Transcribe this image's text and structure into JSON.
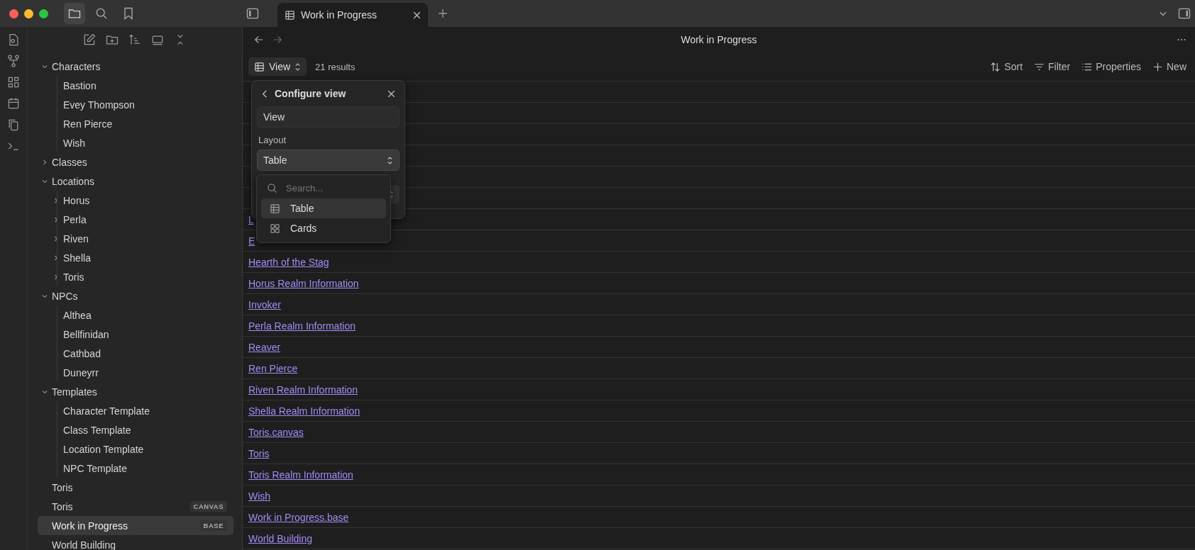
{
  "tab": {
    "title": "Work in Progress"
  },
  "header": {
    "title": "Work in Progress"
  },
  "toolbar": {
    "view_label": "View",
    "results": "21 results",
    "actions": [
      {
        "kind": "sort",
        "label": "Sort"
      },
      {
        "kind": "filter",
        "label": "Filter"
      },
      {
        "kind": "properties",
        "label": "Properties"
      },
      {
        "kind": "new",
        "label": "New"
      }
    ]
  },
  "sidebar": {
    "items": [
      {
        "kind": "folder",
        "label": "Characters",
        "expanded": true,
        "children": [
          {
            "kind": "file",
            "label": "Bastion"
          },
          {
            "kind": "file",
            "label": "Evey Thompson"
          },
          {
            "kind": "file",
            "label": "Ren Pierce"
          },
          {
            "kind": "file",
            "label": "Wish"
          }
        ]
      },
      {
        "kind": "folder",
        "label": "Classes",
        "expanded": false
      },
      {
        "kind": "folder",
        "label": "Locations",
        "expanded": true,
        "children": [
          {
            "kind": "folder",
            "label": "Horus",
            "expanded": false
          },
          {
            "kind": "folder",
            "label": "Perla",
            "expanded": false
          },
          {
            "kind": "folder",
            "label": "Riven",
            "expanded": false
          },
          {
            "kind": "folder",
            "label": "Shella",
            "expanded": false
          },
          {
            "kind": "folder",
            "label": "Toris",
            "expanded": false
          }
        ]
      },
      {
        "kind": "folder",
        "label": "NPCs",
        "expanded": true,
        "children": [
          {
            "kind": "file",
            "label": "Althea"
          },
          {
            "kind": "file",
            "label": "Bellfinidan"
          },
          {
            "kind": "file",
            "label": "Cathbad"
          },
          {
            "kind": "file",
            "label": "Duneyrr"
          }
        ]
      },
      {
        "kind": "folder",
        "label": "Templates",
        "expanded": true,
        "children": [
          {
            "kind": "file",
            "label": "Character Template"
          },
          {
            "kind": "file",
            "label": "Class Template"
          },
          {
            "kind": "file",
            "label": "Location Template"
          },
          {
            "kind": "file",
            "label": "NPC Template"
          }
        ]
      },
      {
        "kind": "file",
        "label": "Toris",
        "selected": false
      },
      {
        "kind": "file",
        "label": "Toris",
        "badge": "CANVAS",
        "selected": false
      },
      {
        "kind": "file",
        "label": "Work in Progress",
        "badge": "BASE",
        "selected": true
      },
      {
        "kind": "file",
        "label": "World Building",
        "selected": false
      }
    ]
  },
  "table": {
    "rows": [
      "L",
      "E",
      "Hearth of the Stag",
      "Horus Realm Information",
      "Invoker",
      "Perla Realm Information",
      "Reaver",
      "Ren Pierce",
      "Riven Realm Information",
      "Shella Realm Information",
      "Toris.canvas",
      "Toris",
      "Toris Realm Information",
      "Wish",
      "Work in Progress.base",
      "World Building"
    ]
  },
  "configure_view": {
    "title": "Configure view",
    "name_value": "View",
    "layout_label": "Layout",
    "layout_value": "Table",
    "dropdown": {
      "placeholder": "Search...",
      "options": [
        {
          "kind": "table",
          "label": "Table",
          "selected": true
        },
        {
          "kind": "cards",
          "label": "Cards",
          "selected": false
        }
      ]
    }
  }
}
